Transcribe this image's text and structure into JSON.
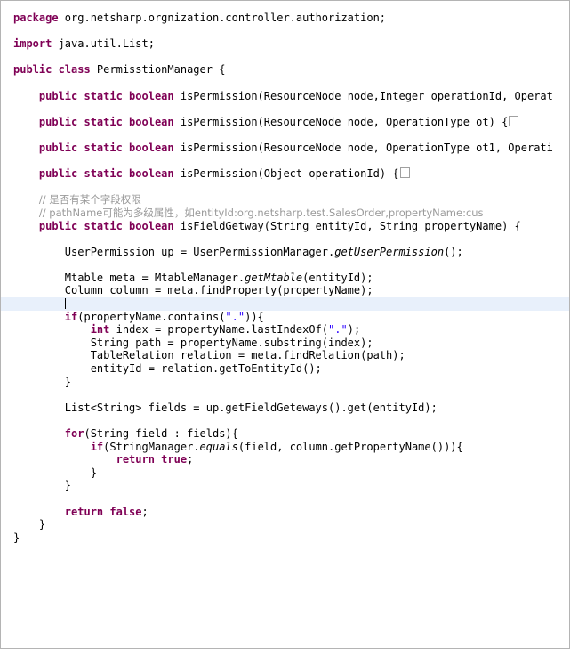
{
  "editor": {
    "language": "java",
    "colors": {
      "keyword": "#7f0055",
      "comment": "#9a9a9a",
      "string": "#2a00ff",
      "text": "#000000",
      "background": "#ffffff",
      "current_line_highlight": "#e8f0fb",
      "border": "#b4b4b4"
    }
  },
  "lines": [
    {
      "id": "l1",
      "segments": [
        {
          "t": "package",
          "c": "kw"
        },
        {
          "t": " org.netsharp.orgnization.controller.authorization;",
          "c": "plain"
        }
      ]
    },
    {
      "id": "l2",
      "segments": []
    },
    {
      "id": "l3",
      "segments": [
        {
          "t": "import",
          "c": "kw"
        },
        {
          "t": " java.util.List;",
          "c": "plain"
        }
      ]
    },
    {
      "id": "l4",
      "segments": []
    },
    {
      "id": "l5",
      "segments": [
        {
          "t": "public class",
          "c": "kw"
        },
        {
          "t": " PermisstionManager {",
          "c": "plain"
        }
      ]
    },
    {
      "id": "l6",
      "segments": []
    },
    {
      "id": "l7",
      "segments": [
        {
          "t": "    ",
          "c": "plain"
        },
        {
          "t": "public static boolean",
          "c": "kw"
        },
        {
          "t": " isPermission(ResourceNode node,Integer operationId, Operat",
          "c": "plain"
        }
      ]
    },
    {
      "id": "l8",
      "segments": []
    },
    {
      "id": "l9",
      "segments": [
        {
          "t": "    ",
          "c": "plain"
        },
        {
          "t": "public static boolean",
          "c": "kw"
        },
        {
          "t": " isPermission(ResourceNode node, OperationType ot) {",
          "c": "plain"
        },
        {
          "t": "",
          "c": "fold"
        }
      ]
    },
    {
      "id": "l10",
      "segments": []
    },
    {
      "id": "l11",
      "segments": [
        {
          "t": "    ",
          "c": "plain"
        },
        {
          "t": "public static boolean",
          "c": "kw"
        },
        {
          "t": " isPermission(ResourceNode node, OperationType ot1, Operati",
          "c": "plain"
        }
      ]
    },
    {
      "id": "l12",
      "segments": []
    },
    {
      "id": "l13",
      "segments": [
        {
          "t": "    ",
          "c": "plain"
        },
        {
          "t": "public static boolean",
          "c": "kw"
        },
        {
          "t": " isPermission(Object operationId) {",
          "c": "plain"
        },
        {
          "t": "",
          "c": "fold"
        }
      ]
    },
    {
      "id": "l14",
      "segments": []
    },
    {
      "id": "l15",
      "segments": [
        {
          "t": "    ",
          "c": "plain"
        },
        {
          "t": "// 是否有某个字段权限",
          "c": "cmt"
        }
      ]
    },
    {
      "id": "l16",
      "segments": [
        {
          "t": "    ",
          "c": "plain"
        },
        {
          "t": "// pathName可能为多级属性，如entityId:org.netsharp.test.SalesOrder,propertyName:cus",
          "c": "cmt"
        }
      ]
    },
    {
      "id": "l17",
      "segments": [
        {
          "t": "    ",
          "c": "plain"
        },
        {
          "t": "public static boolean",
          "c": "kw"
        },
        {
          "t": " isFieldGetway(String entityId, String propertyName) {",
          "c": "plain"
        }
      ]
    },
    {
      "id": "l18",
      "segments": []
    },
    {
      "id": "l19",
      "segments": [
        {
          "t": "        UserPermission up = UserPermissionManager.",
          "c": "plain"
        },
        {
          "t": "getUserPermission",
          "c": "stat"
        },
        {
          "t": "();",
          "c": "plain"
        }
      ]
    },
    {
      "id": "l20",
      "segments": []
    },
    {
      "id": "l21",
      "segments": [
        {
          "t": "        Mtable meta = MtableManager.",
          "c": "plain"
        },
        {
          "t": "getMtable",
          "c": "stat"
        },
        {
          "t": "(entityId);",
          "c": "plain"
        }
      ]
    },
    {
      "id": "l22",
      "segments": [
        {
          "t": "        Column column = meta.findProperty(propertyName);",
          "c": "plain"
        }
      ]
    },
    {
      "id": "l23",
      "current": true,
      "segments": [
        {
          "t": "        ",
          "c": "plain"
        },
        {
          "t": "",
          "c": "caret"
        }
      ]
    },
    {
      "id": "l24",
      "segments": [
        {
          "t": "        ",
          "c": "plain"
        },
        {
          "t": "if",
          "c": "kw"
        },
        {
          "t": "(propertyName.contains(",
          "c": "plain"
        },
        {
          "t": "\".\"",
          "c": "str"
        },
        {
          "t": ")){",
          "c": "plain"
        }
      ]
    },
    {
      "id": "l25",
      "segments": [
        {
          "t": "            ",
          "c": "plain"
        },
        {
          "t": "int",
          "c": "kw"
        },
        {
          "t": " index = propertyName.lastIndexOf(",
          "c": "plain"
        },
        {
          "t": "\".\"",
          "c": "str"
        },
        {
          "t": ");",
          "c": "plain"
        }
      ]
    },
    {
      "id": "l26",
      "segments": [
        {
          "t": "            String path = propertyName.substring(index);",
          "c": "plain"
        }
      ]
    },
    {
      "id": "l27",
      "segments": [
        {
          "t": "            TableRelation relation = meta.findRelation(path);",
          "c": "plain"
        }
      ]
    },
    {
      "id": "l28",
      "segments": [
        {
          "t": "            entityId = relation.getToEntityId();",
          "c": "plain"
        }
      ]
    },
    {
      "id": "l29",
      "segments": [
        {
          "t": "        }",
          "c": "plain"
        }
      ]
    },
    {
      "id": "l30",
      "segments": []
    },
    {
      "id": "l31",
      "segments": [
        {
          "t": "        List<String> fields = up.getFieldGeteways().get(entityId);",
          "c": "plain"
        }
      ]
    },
    {
      "id": "l32",
      "segments": []
    },
    {
      "id": "l33",
      "segments": [
        {
          "t": "        ",
          "c": "plain"
        },
        {
          "t": "for",
          "c": "kw"
        },
        {
          "t": "(String field : fields){",
          "c": "plain"
        }
      ]
    },
    {
      "id": "l34",
      "segments": [
        {
          "t": "            ",
          "c": "plain"
        },
        {
          "t": "if",
          "c": "kw"
        },
        {
          "t": "(StringManager.",
          "c": "plain"
        },
        {
          "t": "equals",
          "c": "stat"
        },
        {
          "t": "(field, column.getPropertyName())){",
          "c": "plain"
        }
      ]
    },
    {
      "id": "l35",
      "segments": [
        {
          "t": "                ",
          "c": "plain"
        },
        {
          "t": "return true",
          "c": "kw"
        },
        {
          "t": ";",
          "c": "plain"
        }
      ]
    },
    {
      "id": "l36",
      "segments": [
        {
          "t": "            }",
          "c": "plain"
        }
      ]
    },
    {
      "id": "l37",
      "segments": [
        {
          "t": "        }",
          "c": "plain"
        }
      ]
    },
    {
      "id": "l38",
      "segments": []
    },
    {
      "id": "l39",
      "segments": [
        {
          "t": "        ",
          "c": "plain"
        },
        {
          "t": "return false",
          "c": "kw"
        },
        {
          "t": ";",
          "c": "plain"
        }
      ]
    },
    {
      "id": "l40",
      "segments": [
        {
          "t": "    }",
          "c": "plain"
        }
      ]
    },
    {
      "id": "l41",
      "segments": [
        {
          "t": "}",
          "c": "plain"
        }
      ]
    }
  ]
}
